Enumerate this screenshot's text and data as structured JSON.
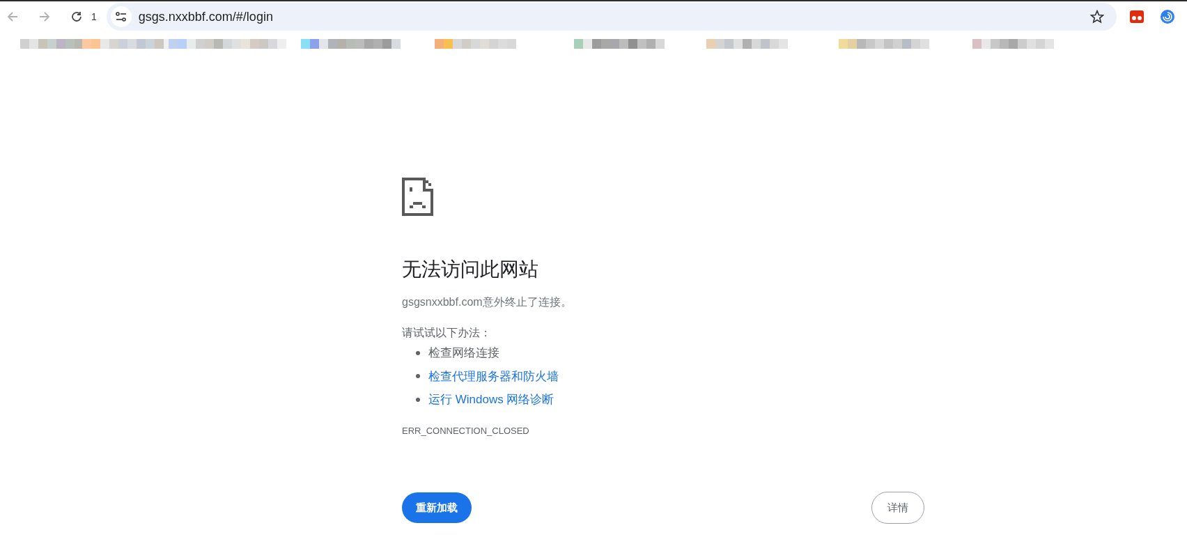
{
  "toolbar": {
    "navigation": {
      "back_disabled": true,
      "forward_disabled": true
    },
    "counter": "1",
    "url": "gsgs.nxxbbf.com/#/login"
  },
  "error": {
    "title": "无法访问此网站",
    "message": "gsgsnxxbbf.com意外终止了连接。",
    "suggestions_heading": "请试试以下办法：",
    "suggestions": [
      {
        "text": "检查网络连接",
        "kind": "plain"
      },
      {
        "text": "检查代理服务器和防火墙",
        "kind": "link"
      },
      {
        "text": "运行 Windows 网络诊断",
        "kind": "link"
      }
    ],
    "code": "ERR_CONNECTION_CLOSED"
  },
  "buttons": [
    {
      "label": "重新加载",
      "kind": "primary"
    },
    {
      "label": "详情",
      "kind": "secondary"
    }
  ]
}
